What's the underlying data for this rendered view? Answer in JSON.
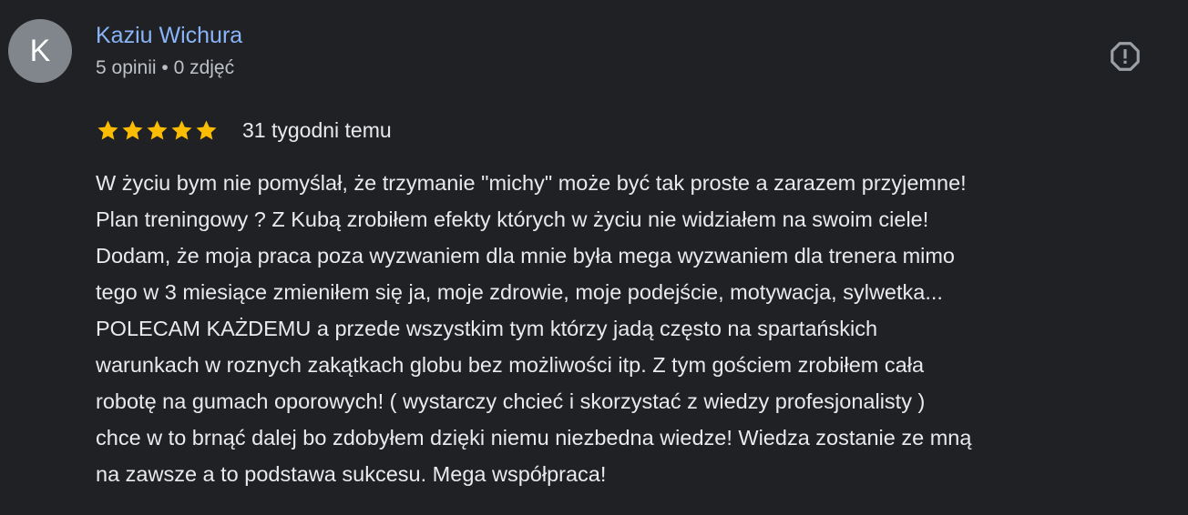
{
  "review": {
    "author": {
      "initial": "K",
      "name": "Kaziu Wichura",
      "meta": "5 opinii • 0 zdjęć"
    },
    "rating": {
      "stars": 5,
      "max": 5,
      "star_color": "#fbbc04"
    },
    "time_ago": "31 tygodni temu",
    "text_lines": [
      "W życiu bym nie pomyślał, że trzymanie \"michy\" może być tak proste a zarazem przyjemne!",
      "Plan treningowy ? Z Kubą zrobiłem efekty których w życiu nie widziałem na swoim ciele!",
      "Dodam, że moja praca poza wyzwaniem dla mnie była mega wyzwaniem dla trenera mimo",
      "tego w 3 miesiące zmieniłem się ja, moje zdrowie, moje podejście, motywacja, sylwetka...",
      "POLECAM KAŻDEMU a przede wszystkim tym którzy jadą często na spartańskich",
      "warunkach w roznych zakątkach globu bez możliwości itp. Z tym gościem zrobiłem cała",
      "robotę na gumach oporowych! ( wystarczy chcieć i skorzystać z wiedzy profesjonalisty )",
      "chce w to brnąć dalej bo zdobyłem dzięki niemu niezbedna wiedze! Wiedza zostanie ze mną",
      "na zawsze a to podstawa sukcesu. Mega współpraca!"
    ],
    "icons": {
      "report": "report-icon",
      "star": "star-icon"
    },
    "colors": {
      "background": "#202124",
      "author_name": "#8ab4f8",
      "avatar_bg": "#80868b",
      "text": "#e8eaed",
      "secondary_text": "#bdc1c6",
      "icon": "#9aa0a6"
    }
  }
}
